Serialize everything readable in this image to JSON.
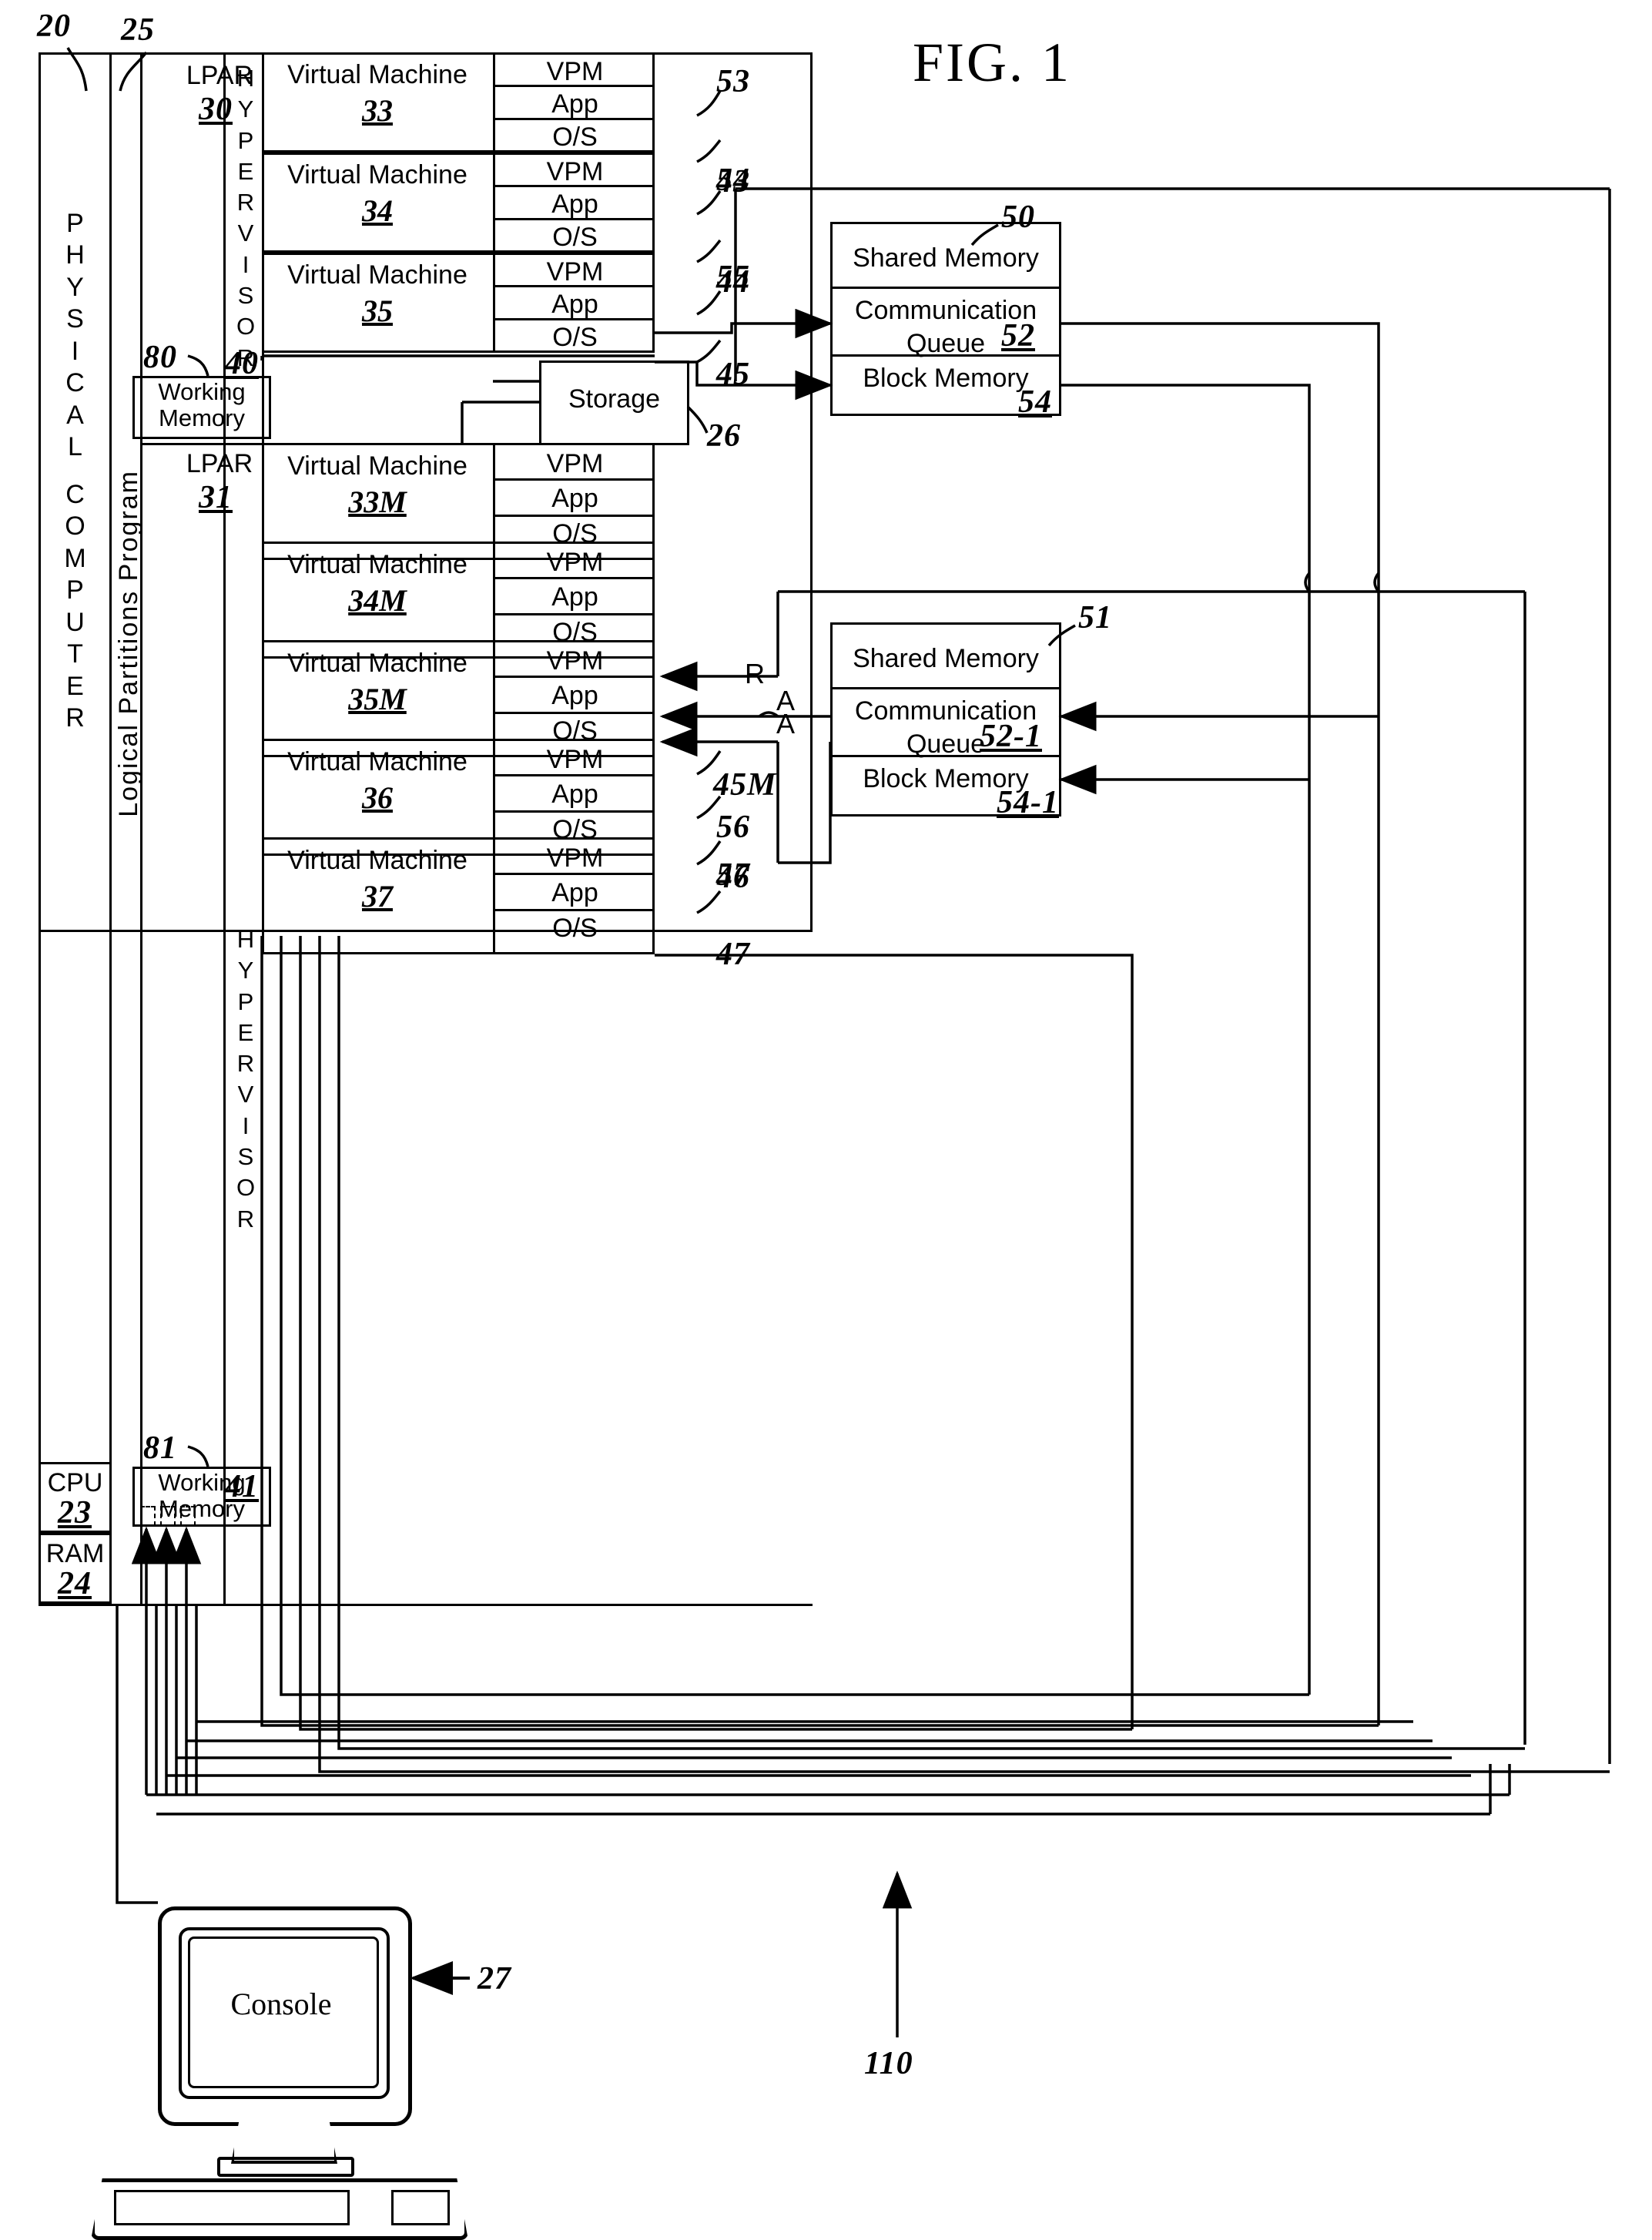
{
  "figure": {
    "title": "FIG. 1"
  },
  "refs": {
    "r20": "20",
    "r25": "25",
    "r23": "23",
    "r24": "24",
    "r26": "26",
    "r27": "27",
    "r30": "30",
    "r31": "31",
    "r40": "40",
    "r41": "41",
    "r50": "50",
    "r51": "51",
    "r80": "80",
    "r81": "81",
    "r110": "110",
    "r43": "43",
    "r44": "44",
    "r45": "45",
    "r45M": "45M",
    "r46": "46",
    "r47": "47",
    "r53": "53",
    "r54": "54",
    "r55": "55",
    "r56": "56",
    "r57": "57"
  },
  "physical_computer": {
    "label": "PHYSICAL COMPUTER",
    "letters": [
      "P",
      "H",
      "Y",
      "S",
      "I",
      "C",
      "A",
      "L",
      "",
      "C",
      "O",
      "M",
      "P",
      "U",
      "T",
      "E",
      "R"
    ],
    "cpu": {
      "label": "CPU",
      "ref": "23"
    },
    "ram": {
      "label": "RAM",
      "ref": "24"
    }
  },
  "lpp": {
    "label": "Logical Partitions Program",
    "ref": "25"
  },
  "hypervisor_word": "HYPERVISOR",
  "lpar_top": {
    "label": "LPAR",
    "ref": "30",
    "hypervisor_ref": "40",
    "working_memory": {
      "label": "Working Memory",
      "ref": "80"
    },
    "vms": [
      {
        "name": "Virtual Machine",
        "ref": "33",
        "rows": [
          "VPM",
          "App",
          "O/S"
        ],
        "callouts": [
          "53",
          "43"
        ]
      },
      {
        "name": "Virtual Machine",
        "ref": "34",
        "rows": [
          "VPM",
          "App",
          "O/S"
        ],
        "callouts": [
          "54",
          "44"
        ]
      },
      {
        "name": "Virtual Machine",
        "ref": "35",
        "rows": [
          "VPM",
          "App",
          "O/S"
        ],
        "callouts": [
          "55",
          "45"
        ]
      }
    ]
  },
  "storage": {
    "label": "Storage",
    "ref": "26"
  },
  "lpar_bottom": {
    "label": "LPAR",
    "ref": "31",
    "hypervisor_ref": "41",
    "working_memory": {
      "label": "Working Memory",
      "ref": "81"
    },
    "vms": [
      {
        "name": "Virtual Machine",
        "ref": "33M",
        "rows": [
          "VPM",
          "App",
          "O/S"
        ],
        "callouts": []
      },
      {
        "name": "Virtual Machine",
        "ref": "34M",
        "rows": [
          "VPM",
          "App",
          "O/S"
        ],
        "callouts": []
      },
      {
        "name": "Virtual Machine",
        "ref": "35M",
        "rows": [
          "VPM",
          "App",
          "O/S"
        ],
        "callouts": []
      },
      {
        "name": "Virtual Machine",
        "ref": "36",
        "rows": [
          "VPM",
          "App",
          "O/S"
        ],
        "callouts": [
          "45M",
          "56",
          "46"
        ]
      },
      {
        "name": "Virtual Machine",
        "ref": "37",
        "rows": [
          "VPM",
          "App",
          "O/S"
        ],
        "callouts": [
          "57",
          "47"
        ]
      }
    ]
  },
  "shared_memory_top": {
    "ref": "50",
    "rows": [
      {
        "label": "Shared Memory",
        "ref": ""
      },
      {
        "label": "Communication Queue",
        "ref": "52"
      },
      {
        "label": "Block Memory",
        "ref": "54"
      }
    ]
  },
  "shared_memory_bottom": {
    "ref": "51",
    "rows": [
      {
        "label": "Shared Memory",
        "ref": ""
      },
      {
        "label": "Communication Queue",
        "ref": "52-1"
      },
      {
        "label": "Block Memory",
        "ref": "54-1"
      }
    ]
  },
  "arrow_labels": {
    "r": "R",
    "a1": "A",
    "a2": "A"
  },
  "console": {
    "label": "Console",
    "ref": "27"
  },
  "system_ref": "110"
}
